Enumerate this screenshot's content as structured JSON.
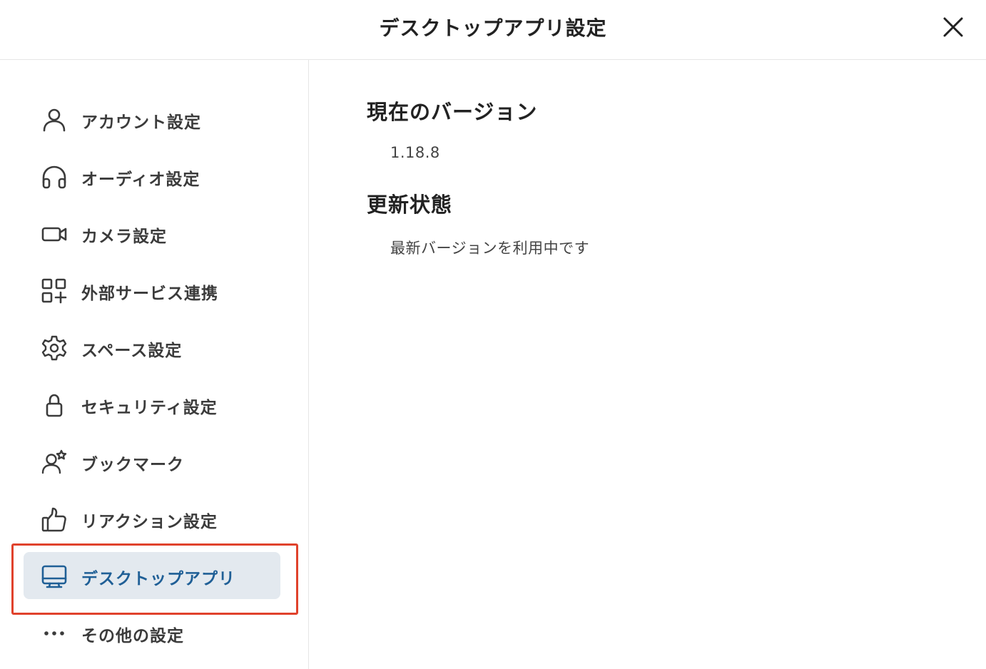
{
  "header": {
    "title": "デスクトップアプリ設定",
    "close_icon": "close-icon"
  },
  "sidebar": {
    "items": [
      {
        "label": "アカウント設定",
        "icon": "user-icon"
      },
      {
        "label": "オーディオ設定",
        "icon": "headphones-icon"
      },
      {
        "label": "カメラ設定",
        "icon": "video-camera-icon"
      },
      {
        "label": "外部サービス連携",
        "icon": "apps-add-icon"
      },
      {
        "label": "スペース設定",
        "icon": "gear-icon"
      },
      {
        "label": "セキュリティ設定",
        "icon": "lock-icon"
      },
      {
        "label": "ブックマーク",
        "icon": "user-star-icon"
      },
      {
        "label": "リアクション設定",
        "icon": "thumbs-up-icon"
      },
      {
        "label": "デスクトップアプリ",
        "icon": "monitor-icon",
        "active": true
      },
      {
        "label": "その他の設定",
        "icon": "more-horizontal-icon"
      }
    ],
    "highlight_color": "#e0422c",
    "active_color": "#1f5f96"
  },
  "main": {
    "version_title": "現在のバージョン",
    "version_value": "1.18.8",
    "update_title": "更新状態",
    "update_value": "最新バージョンを利用中です"
  }
}
